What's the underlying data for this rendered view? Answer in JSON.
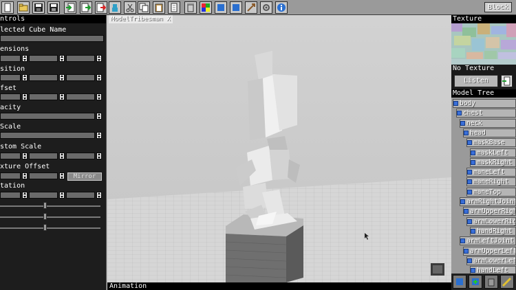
{
  "toolbar": {
    "buttons": [
      "new-icon",
      "open-icon",
      "save-icon",
      "save-as-icon",
      "import-icon",
      "export-icon",
      "export-alt-icon",
      "character-icon",
      "cut-icon",
      "copy-icon",
      "paste-icon",
      "document-icon",
      "delete-icon",
      "color-icon",
      "cube-icon",
      "rotate-icon",
      "scale-icon",
      "settings-icon",
      "info-icon"
    ],
    "block_label": "Block"
  },
  "controls": {
    "header": "ntrols",
    "selected_cube_name": "lected Cube Name",
    "dimensions": "ensions",
    "position": "sition",
    "offset": "fset",
    "opacity": "acity",
    "scale": "Scale",
    "custom_scale": "stom Scale",
    "texture_offset": "xture Offset",
    "mirror": "Mirror",
    "rotation": "tation"
  },
  "viewport": {
    "tab": "ModelTribesman X",
    "animation": "Animation"
  },
  "texture": {
    "header": "Texture",
    "no_texture": "No Texture",
    "listen": "Listen"
  },
  "tree": {
    "header": "Model Tree",
    "items": [
      {
        "label": "body",
        "depth": 0
      },
      {
        "label": "chest",
        "depth": 1
      },
      {
        "label": "neck",
        "depth": 2
      },
      {
        "label": "head",
        "depth": 3
      },
      {
        "label": "maskBase",
        "depth": 4
      },
      {
        "label": "maskLeft",
        "depth": 5
      },
      {
        "label": "maskRight",
        "depth": 5
      },
      {
        "label": "maneLeft",
        "depth": 4
      },
      {
        "label": "maneRight",
        "depth": 4
      },
      {
        "label": "maneTop",
        "depth": 4
      },
      {
        "label": "armRightJoint",
        "depth": 2
      },
      {
        "label": "armUpperRight",
        "depth": 3
      },
      {
        "label": "armLowerRight",
        "depth": 4
      },
      {
        "label": "handRight",
        "depth": 5
      },
      {
        "label": "armLeftJoint",
        "depth": 2
      },
      {
        "label": "armUpperLeft",
        "depth": 3
      },
      {
        "label": "armLowerLeft",
        "depth": 4
      },
      {
        "label": "handLeft",
        "depth": 5
      }
    ]
  },
  "colors": {
    "panel_bg": "#1d1d1d",
    "viewport_bg": "#cfcfcf",
    "tree_icon": "#3a6fd8"
  }
}
